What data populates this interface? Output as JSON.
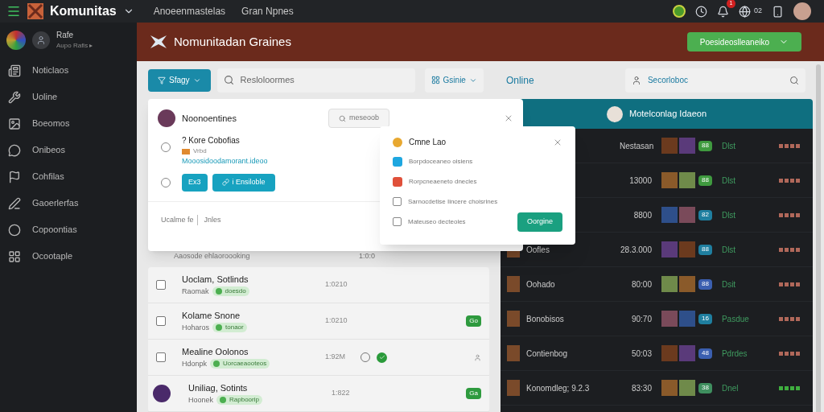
{
  "topbar": {
    "brand": "Komunitas",
    "nav": [
      "Anoeenmastelas",
      "Gran Npnes"
    ],
    "notification_count": "1",
    "globe_count": "02"
  },
  "sidebar": {
    "profile": {
      "name": "Rafe",
      "sub": "Aupo Rafis ▸"
    },
    "items": [
      {
        "label": "Noticlaos"
      },
      {
        "label": "Uoline"
      },
      {
        "label": "Boeomos"
      },
      {
        "label": "Onibeos"
      },
      {
        "label": "Cohfilas"
      },
      {
        "label": "Gaoerlerfas"
      },
      {
        "label": "Copoontias"
      },
      {
        "label": "Ocootaple"
      }
    ]
  },
  "header": {
    "title": "Nomunitadan Graines",
    "action": "Poesideoslleaneiko"
  },
  "toolbar": {
    "filter": "Sfagy",
    "search_placeholder": "Resloloormes",
    "view": "Gsinie",
    "online_label": "Online",
    "people_search_placeholder": "Secorloboc"
  },
  "card": {
    "title": "Noonoentines",
    "search_button": "meseoob",
    "item_title": "? Kore Cobofias",
    "item_meta": "Vrbd",
    "item_link": "Mooosidoodamorant.ideoo",
    "buttons": [
      "Ex3",
      "i Ensiloble"
    ],
    "footer": [
      "Ucalme fe",
      "Jnles"
    ]
  },
  "hidden_row": {
    "text": "Aaosode ehlaoroooking",
    "time": "1:0:0"
  },
  "menu": {
    "title": "Cmne Lao",
    "items": [
      {
        "kind": "icon",
        "label": "Borpdoceaneo oisiens",
        "color": "#1ea7e0"
      },
      {
        "kind": "icon",
        "label": "Rorpcneaeneto dnecles",
        "color": "#e0503a"
      },
      {
        "kind": "checkbox",
        "label": "Sarnocdetise Iincere choisrines",
        "checked": false
      },
      {
        "kind": "checkbox",
        "label": "Mateuseo decteoles",
        "checked": false
      }
    ],
    "button": "Oorgine"
  },
  "list": [
    {
      "kind": "checkbox",
      "name": "Uoclam, Sotlinds",
      "sub": "Raomak",
      "tag": "doesdo",
      "time": "1:0210",
      "checked": false,
      "verified": false
    },
    {
      "kind": "checkbox",
      "name": "Kolame Snone",
      "sub": "Hoharos",
      "tag": "tonaor",
      "time": "1:0210",
      "checked": false,
      "verified": false,
      "badge": "Go"
    },
    {
      "kind": "checkbox",
      "name": "Mealine Oolonos",
      "sub": "Hdonpk",
      "tag": "Uorcaeaooteos",
      "time": "1:92M",
      "checked": false,
      "verified": true
    },
    {
      "kind": "avatar",
      "name": "Uniliag, Sotints",
      "sub": "Hoonek",
      "tag": "Rapboorip",
      "time": "1:822",
      "verified": false,
      "badge": "Ga"
    }
  ],
  "panel": {
    "title": "Motelconlag Idaeon",
    "rows": [
      {
        "value": "Nestasan",
        "badge": {
          "text": "88",
          "color": "#3f9a3f"
        },
        "status": "Dlst",
        "dots": {
          "color": "#b0685a"
        }
      },
      {
        "value": "13000",
        "badge": {
          "text": "88",
          "color": "#3f9a3f"
        },
        "status": "Dlst",
        "dots": {
          "color": "#b0685a"
        }
      },
      {
        "value": "8800",
        "badge": {
          "text": "82",
          "color": "#1f7fa0"
        },
        "status": "Dlst",
        "dots": {
          "color": "#b0685a"
        }
      },
      {
        "name": "Oofles",
        "value": "28.3.000",
        "badge": {
          "text": "88",
          "color": "#1f7fa0"
        },
        "status": "Dlst",
        "dots": {
          "color": "#b0685a"
        }
      },
      {
        "name": "Oohado",
        "value": "80:00",
        "badge": {
          "text": "88",
          "color": "#3b5fb0"
        },
        "status": "Dsit",
        "dots": {
          "color": "#b0685a"
        }
      },
      {
        "name": "Bonobisos",
        "value": "90:70",
        "badge": {
          "text": "16",
          "color": "#1f7fa0"
        },
        "status": "Pasdue",
        "dots": {
          "color": "#b0685a"
        }
      },
      {
        "name": "Contienbog",
        "value": "50:03",
        "badge": {
          "text": "48",
          "color": "#3b5fb0"
        },
        "status": "Pdrdes",
        "dots": {
          "color": "#b0685a"
        }
      },
      {
        "name": "Konomdleg; 9.2.3",
        "value": "83:30",
        "badge": {
          "text": "38",
          "color": "#3f8f5f"
        },
        "status": "Dnel",
        "dots": {
          "color": "#3fae3f"
        }
      }
    ]
  }
}
